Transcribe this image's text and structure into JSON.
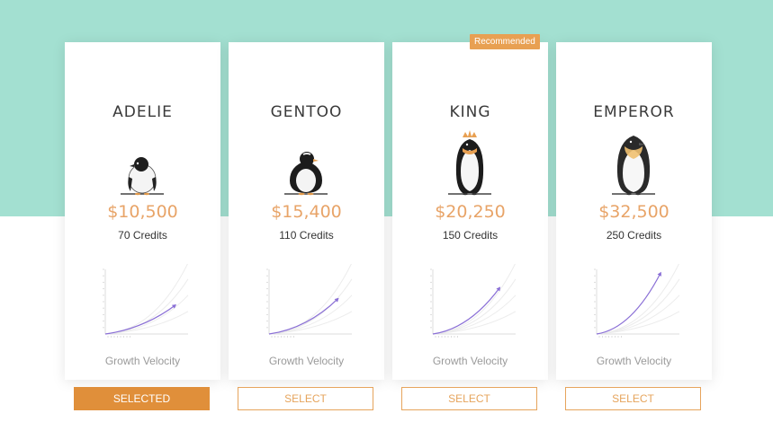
{
  "badge": {
    "text": "Recommended"
  },
  "metric_label": "Growth Velocity",
  "colors": {
    "band": "#a3e0d1",
    "price": "#e8a468",
    "accent": "#e08f3a",
    "curve": "#8a6fd6"
  },
  "plans": [
    {
      "name": "ADELIE",
      "price": "$10,500",
      "credits": "70 Credits",
      "button": "SELECTED",
      "selected": true,
      "growth": 0.45
    },
    {
      "name": "GENTOO",
      "price": "$15,400",
      "credits": "110 Credits",
      "button": "SELECT",
      "selected": false,
      "growth": 0.55
    },
    {
      "name": "KING",
      "price": "$20,250",
      "credits": "150 Credits",
      "button": "SELECT",
      "selected": false,
      "growth": 0.72
    },
    {
      "name": "EMPEROR",
      "price": "$32,500",
      "credits": "250 Credits",
      "button": "SELECT",
      "selected": false,
      "growth": 0.95
    }
  ]
}
